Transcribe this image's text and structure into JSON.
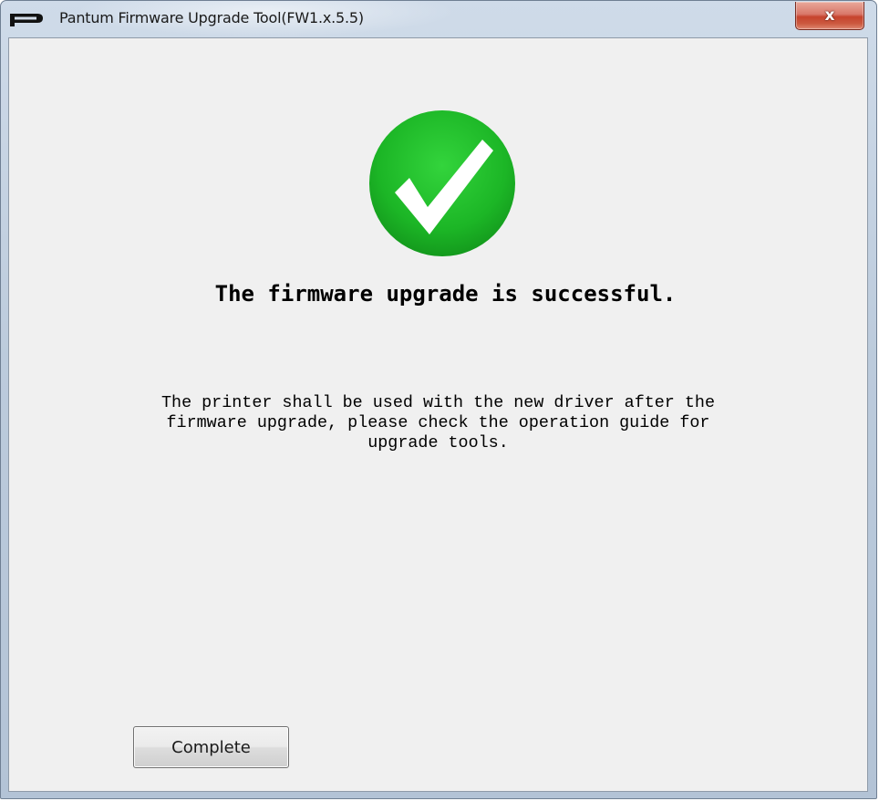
{
  "window": {
    "title": "Pantum  Firmware Upgrade Tool(FW1.x.5.5)",
    "app_icon": "pantum-logo-icon",
    "close_icon": "close-icon",
    "close_glyph": "x"
  },
  "content": {
    "status_icon": "checkmark-success-icon",
    "headline": "The firmware upgrade is successful.",
    "message_lines": [
      "The printer shall be used with the new driver after the",
      "firmware upgrade, please check the operation guide for",
      "upgrade tools."
    ],
    "complete_label": "Complete"
  },
  "colors": {
    "success_green": "#1fb62a",
    "close_red": "#c6432d",
    "dialog_bg": "#f0f0f0"
  }
}
